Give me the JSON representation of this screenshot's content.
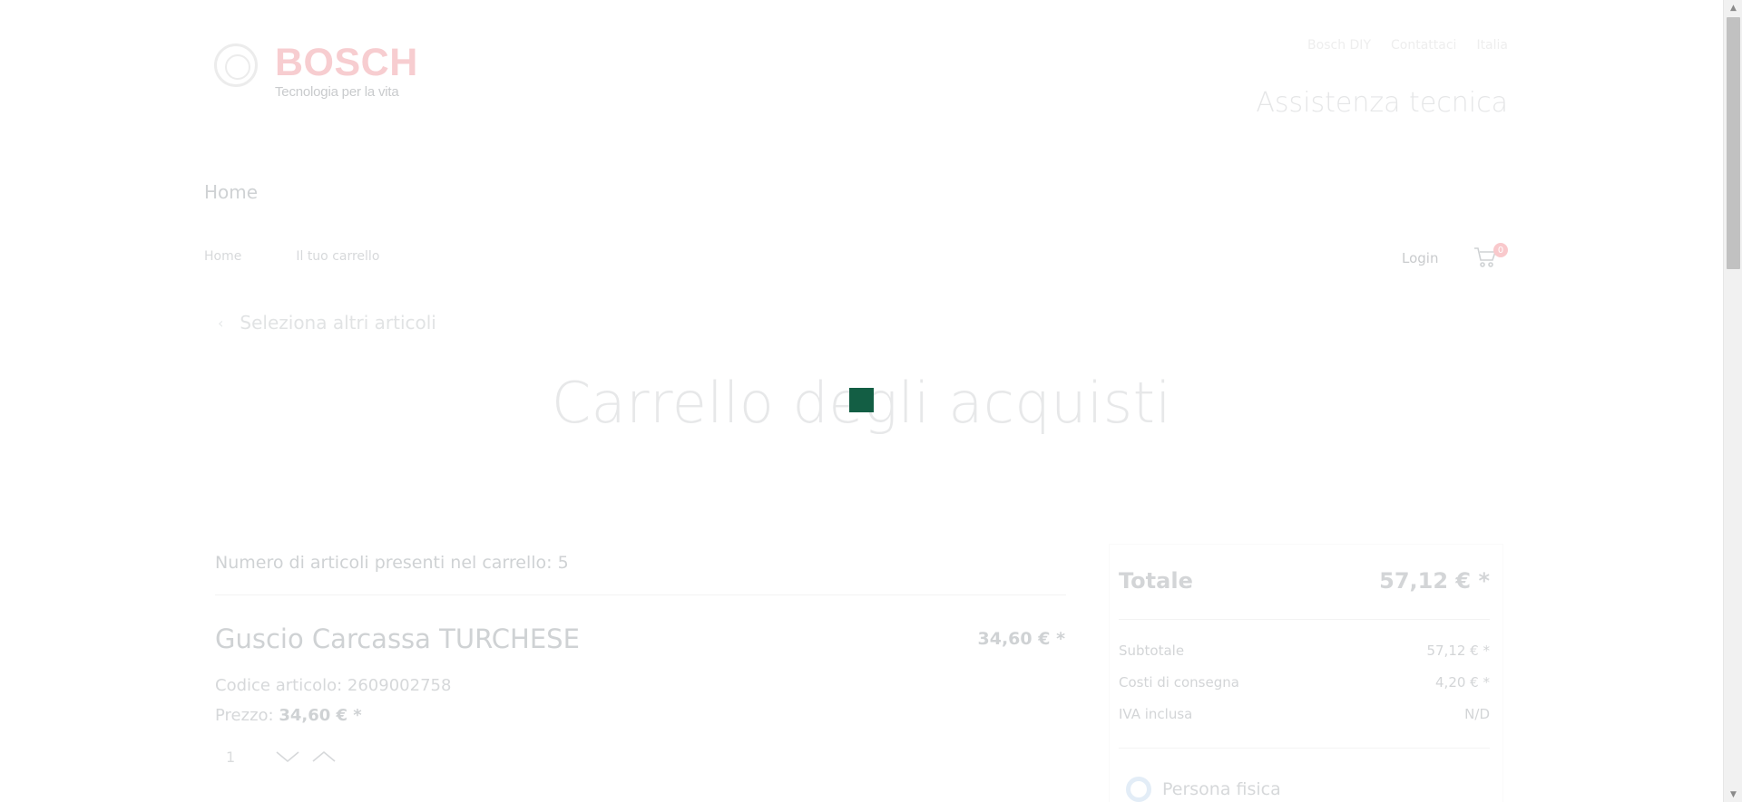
{
  "header": {
    "brand": "BOSCH",
    "tagline": "Tecnologia per la vita",
    "toplinks": [
      "Bosch DIY",
      "Contattaci",
      "Italia"
    ],
    "section_title": "Assistenza tecnica"
  },
  "nav": {
    "home": "Home"
  },
  "breadcrumb": [
    "Home",
    "Il tuo carrello"
  ],
  "account": {
    "login": "Login",
    "cart_count": "0"
  },
  "back_link": "Seleziona altri articoli",
  "page_title": "Carrello degli acquisti",
  "cart": {
    "count_text": "Numero di articoli presenti nel carrello: 5",
    "items": [
      {
        "name": "Guscio Carcassa TURCHESE",
        "price": "34,60  € *",
        "code_label": "Codice articolo: 2609002758",
        "unit_label": "Prezzo: ",
        "unit_price": "34,60  € *",
        "quantity": "1"
      }
    ]
  },
  "summary": {
    "total_label": "Totale",
    "total_value": "57,12  € *",
    "rows": [
      {
        "label": "Subtotale",
        "value": "57,12  € *"
      },
      {
        "label": "Costi di consegna",
        "value": "4,20  € *"
      },
      {
        "label": "IVA inclusa",
        "value": "N/D"
      }
    ],
    "customer_type": "Persona fisica"
  },
  "colors": {
    "loader": "#135e44",
    "brand": "#f7cdd0"
  }
}
